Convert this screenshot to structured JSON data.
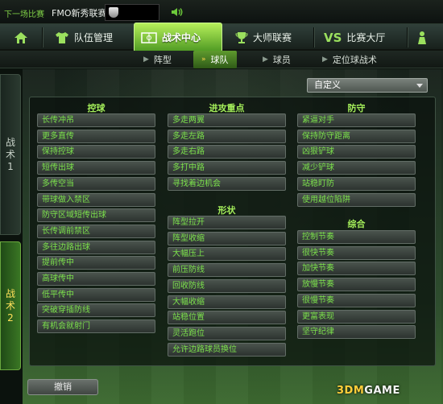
{
  "topbar": {
    "next_match": "下一场比赛",
    "league": "FMO新秀联赛"
  },
  "nav": {
    "team": "队伍管理",
    "tactics": "战术中心",
    "master": "大师联赛",
    "match": "比赛大厅",
    "match_icon": "VS"
  },
  "subnav": {
    "formation": "阵型",
    "team": "球队",
    "player": "球员",
    "setpiece": "定位球战术"
  },
  "side_tabs": {
    "tab1": [
      "战",
      "术",
      "1"
    ],
    "tab2": [
      "战",
      "术",
      "2"
    ]
  },
  "dropdown": {
    "value": "自定义"
  },
  "columns": {
    "control": {
      "title": "控球",
      "options": [
        "长传冲吊",
        "更多直传",
        "保持控球",
        "短传出球",
        "多传空当",
        "带球做入禁区",
        "防守区域短传出球",
        "长传调前禁区",
        "多往边路出球",
        "提前传中",
        "高球传中",
        "低平传中",
        "突破穿插防线",
        "有机会就射门"
      ]
    },
    "attack": {
      "title": "进攻重点",
      "options": [
        "多走两翼",
        "多走左路",
        "多走右路",
        "多打中路",
        "寻找着边机会"
      ]
    },
    "shape": {
      "title": "形状",
      "options": [
        "阵型拉开",
        "阵型收缩",
        "大幅压上",
        "前压防线",
        "回收防线",
        "大幅收缩",
        "站稳位置",
        "灵活跑位",
        "允许边路球员换位"
      ]
    },
    "defense": {
      "title": "防守",
      "options": [
        "紧逼对手",
        "保持防守距离",
        "凶狠铲球",
        "减少铲球",
        "站稳盯防",
        "使用越位陷阱"
      ]
    },
    "general": {
      "title": "综合",
      "options": [
        "控制节奏",
        "很快节奏",
        "加快节奏",
        "放慢节奏",
        "很慢节奏",
        "更富表现",
        "坚守纪律"
      ]
    }
  },
  "undo": "撤销",
  "watermark": {
    "num": "3DM",
    "text": "GAME"
  }
}
